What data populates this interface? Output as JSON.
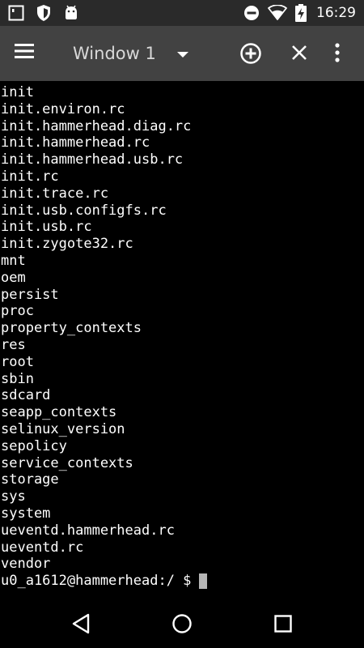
{
  "status_bar": {
    "time": "16:29",
    "icons_left": [
      "terminal-notification-icon",
      "shield-icon",
      "android-icon"
    ],
    "icons_right": [
      "do-not-disturb-icon",
      "wifi-icon",
      "battery-charging-icon"
    ]
  },
  "app_bar": {
    "menu_icon": "hamburger-menu-icon",
    "window_title": "Window 1",
    "dropdown_icon": "chevron-down-icon",
    "add_icon": "add-circle-icon",
    "close_icon": "close-icon",
    "more_icon": "more-vert-icon"
  },
  "terminal": {
    "lines": [
      "init",
      "init.environ.rc",
      "init.hammerhead.diag.rc",
      "init.hammerhead.rc",
      "init.hammerhead.usb.rc",
      "init.rc",
      "init.trace.rc",
      "init.usb.configfs.rc",
      "init.usb.rc",
      "init.zygote32.rc",
      "mnt",
      "oem",
      "persist",
      "proc",
      "property_contexts",
      "res",
      "root",
      "sbin",
      "sdcard",
      "seapp_contexts",
      "selinux_version",
      "sepolicy",
      "service_contexts",
      "storage",
      "sys",
      "system",
      "ueventd.hammerhead.rc",
      "ueventd.rc",
      "vendor"
    ],
    "prompt": "u0_a1612@hammerhead:/ $"
  },
  "nav_bar": {
    "back_icon": "back-triangle-icon",
    "home_icon": "home-circle-icon",
    "recents_icon": "recents-square-icon"
  },
  "colors": {
    "status_bar_bg": "#2a2a2a",
    "app_bar_bg": "#424242",
    "terminal_bg": "#000000",
    "terminal_text": "#ffffff",
    "cursor": "#b5b5b5"
  }
}
